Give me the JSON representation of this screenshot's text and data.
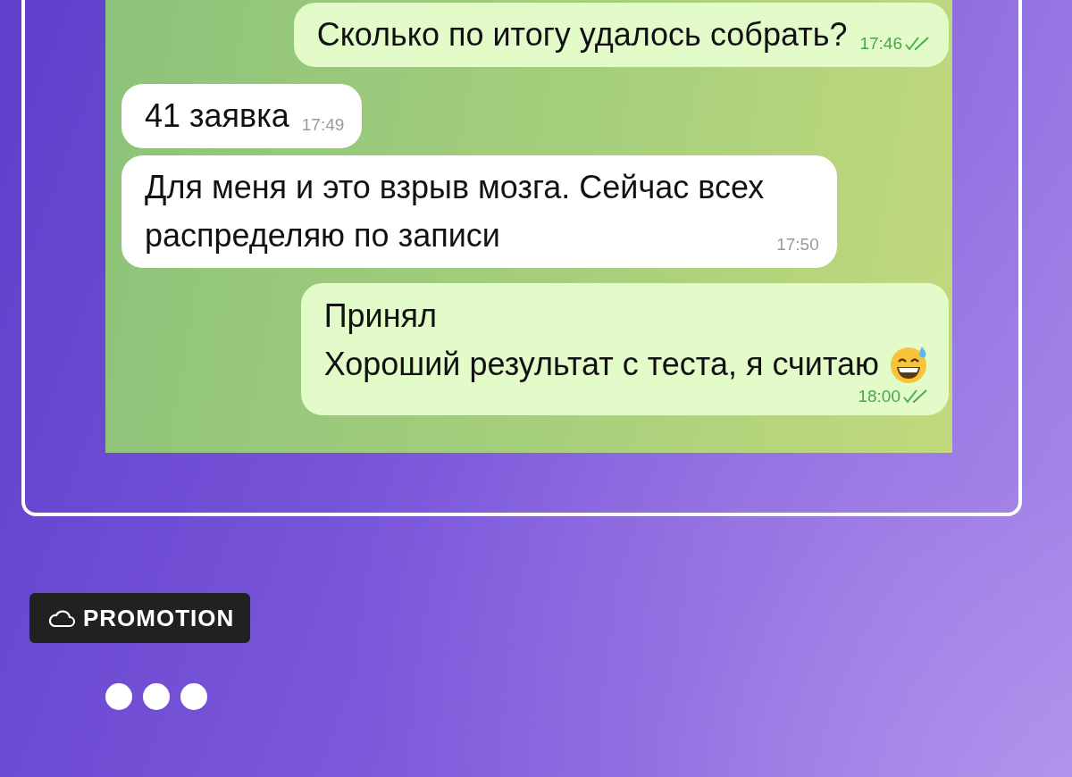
{
  "chat": {
    "messages": [
      {
        "kind": "outgoing",
        "lines": [
          "Сколько по итогу удалось собрать?"
        ],
        "time": "17:46",
        "read": true,
        "emoji": false,
        "time_row": false
      },
      {
        "kind": "incoming",
        "lines": [
          "41 заявка"
        ],
        "time": "17:49",
        "read": false,
        "emoji": false,
        "time_row": false
      },
      {
        "kind": "incoming",
        "lines": [
          "Для меня и это взрыв мозга. Сейчас всех",
          "распределяю по записи"
        ],
        "time": "17:50",
        "read": false,
        "emoji": false,
        "time_row": false
      },
      {
        "kind": "outgoing",
        "lines": [
          "Принял",
          "Хороший результат с теста, я считаю"
        ],
        "time": "18:00",
        "read": true,
        "emoji": true,
        "time_row": true
      }
    ]
  },
  "badge": {
    "label": "PROMOTION"
  }
}
